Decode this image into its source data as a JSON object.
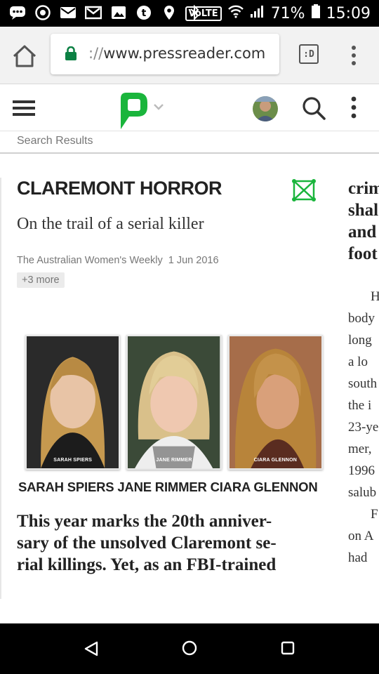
{
  "status_bar": {
    "battery_percent": "71%",
    "time": "15:09",
    "volte_label": "VoLTE"
  },
  "browser": {
    "url_prefix": "://",
    "url_host": "www.pressreader.com",
    "tabs_label": ":D"
  },
  "app_bar": {
    "brand_color": "#1ab53c"
  },
  "sub_bar": {
    "label": "Search Results"
  },
  "article": {
    "headline": "CLAREMONT HORROR",
    "subhead": "On the trail of a serial killer",
    "source": "The Australian Women's Weekly",
    "date": "1 Jun 2016",
    "more_badge": "+3 more",
    "photo_captions": [
      "SARAH SPIERS",
      "JANE RIMMER",
      "CIARA GLENNON"
    ],
    "names_caption": "SARAH SPIERS JANE RIMMER CIARA GLENNON",
    "lead_lines": [
      "This year marks the 20th anniver-",
      "sary of the unsolved Claremont se-",
      "rial killings. Yet, as an FBI-trained"
    ]
  },
  "next_column": {
    "headline_lines": [
      "crim",
      "shal",
      "and",
      "foot"
    ],
    "body_lines": [
      "H",
      "body",
      "long",
      "a lo",
      "south",
      "the i",
      "23-ye",
      "mer,",
      "1996",
      "salub",
      "F",
      "on A",
      "had"
    ]
  }
}
